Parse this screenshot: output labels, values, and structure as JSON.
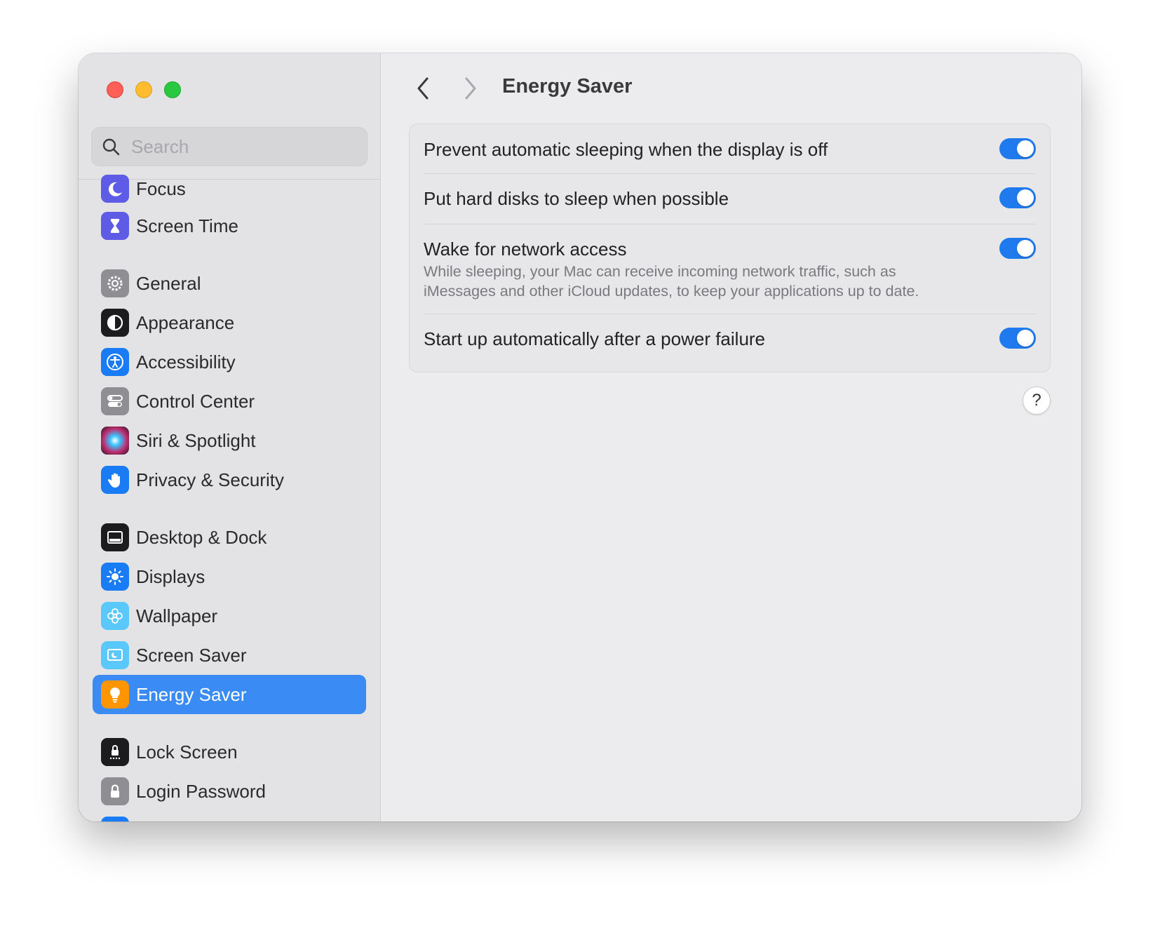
{
  "window": {
    "traffic_lights": [
      "close",
      "minimize",
      "zoom"
    ]
  },
  "sidebar": {
    "search": {
      "placeholder": "Search",
      "value": ""
    },
    "items": [
      {
        "label": "Focus",
        "icon": "moon-icon",
        "color": "#5e5ce6",
        "selected": false
      },
      {
        "label": "Screen Time",
        "icon": "hourglass-icon",
        "color": "#5e5ce6",
        "selected": false
      },
      {
        "label": "General",
        "icon": "gear-icon",
        "color": "#8e8e93",
        "selected": false
      },
      {
        "label": "Appearance",
        "icon": "appearance-icon",
        "color": "#1c1c1e",
        "selected": false
      },
      {
        "label": "Accessibility",
        "icon": "accessibility-icon",
        "color": "#1a7cf5",
        "selected": false
      },
      {
        "label": "Control Center",
        "icon": "control-center-icon",
        "color": "#8e8e93",
        "selected": false
      },
      {
        "label": "Siri & Spotlight",
        "icon": "siri-icon",
        "color": "#c02b6b",
        "selected": false
      },
      {
        "label": "Privacy & Security",
        "icon": "hand-icon",
        "color": "#1a7cf5",
        "selected": false
      },
      {
        "label": "Desktop & Dock",
        "icon": "dock-icon",
        "color": "#1c1c1e",
        "selected": false
      },
      {
        "label": "Displays",
        "icon": "sun-icon",
        "color": "#1a7cf5",
        "selected": false
      },
      {
        "label": "Wallpaper",
        "icon": "flower-icon",
        "color": "#5ac8fa",
        "selected": false
      },
      {
        "label": "Screen Saver",
        "icon": "screen-saver-icon",
        "color": "#5ac8fa",
        "selected": false
      },
      {
        "label": "Energy Saver",
        "icon": "lightbulb-icon",
        "color": "#ff9500",
        "selected": true
      },
      {
        "label": "Lock Screen",
        "icon": "lock-screen-icon",
        "color": "#1c1c1e",
        "selected": false
      },
      {
        "label": "Login Password",
        "icon": "lock-icon",
        "color": "#8e8e93",
        "selected": false
      }
    ]
  },
  "header": {
    "title": "Energy Saver",
    "back_icon": "chevron-left-icon",
    "forward_icon": "chevron-right-icon"
  },
  "settings": [
    {
      "title": "Prevent automatic sleeping when the display is off",
      "description": "",
      "enabled": true
    },
    {
      "title": "Put hard disks to sleep when possible",
      "description": "",
      "enabled": true
    },
    {
      "title": "Wake for network access",
      "description": "While sleeping, your Mac can receive incoming network traffic, such as iMessages and other iCloud updates, to keep your applications up to date.",
      "enabled": true
    },
    {
      "title": "Start up automatically after a power failure",
      "description": "",
      "enabled": true
    }
  ],
  "help": {
    "label": "?"
  },
  "colors": {
    "accent": "#1f7aed",
    "selection": "#3b8bf5"
  }
}
